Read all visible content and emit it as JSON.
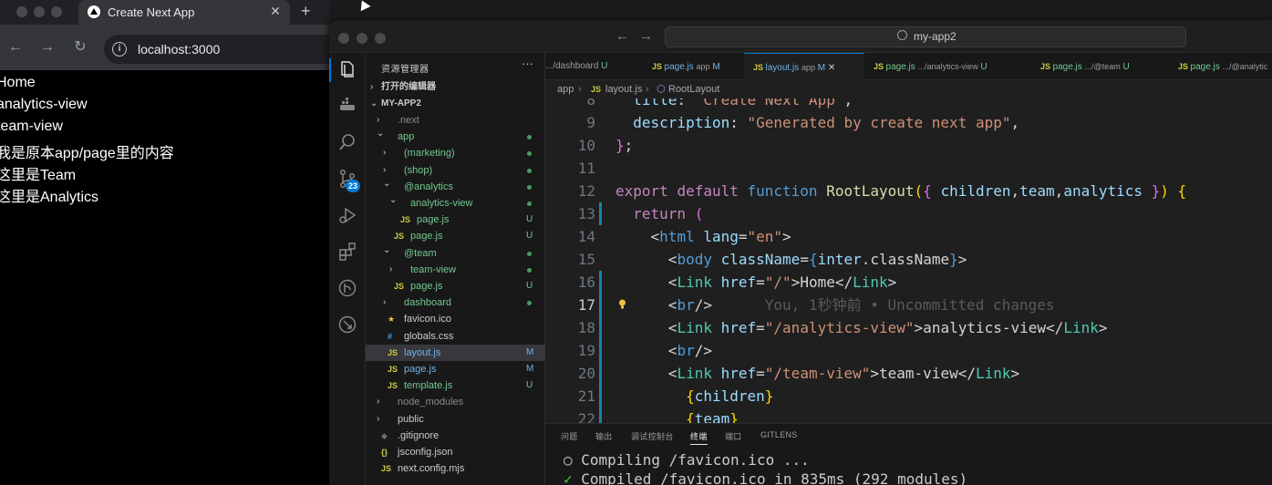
{
  "browser": {
    "tab_title": "Create Next App",
    "url": "localhost:3000",
    "close_glyph": "✕",
    "new_tab_glyph": "+",
    "back_glyph": "←",
    "forward_glyph": "→",
    "reload_glyph": "↻",
    "content_lines": [
      "Home",
      "analytics-view",
      "team-view",
      "我是原本app/page里的内容",
      "这里是Team",
      "这里是Analytics"
    ]
  },
  "vscode": {
    "title_search": "my-app2",
    "explorer": {
      "title": "资源管理器",
      "more": "···",
      "open_editors": "打开的编辑器",
      "project": "MY-APP2",
      "tree": [
        {
          "label": ".next",
          "type": "folder-closed",
          "indent": 0,
          "label_color": "#8b8b8b"
        },
        {
          "label": "app",
          "type": "folder-open",
          "indent": 0,
          "label_color": "#73c991",
          "dot": "#4a9a66"
        },
        {
          "label": "(marketing)",
          "type": "folder-closed",
          "indent": 1,
          "label_color": "#73c991",
          "dot": "#4a9a66"
        },
        {
          "label": "(shop)",
          "type": "folder-closed",
          "indent": 1,
          "label_color": "#73c991",
          "dot": "#4a9a66"
        },
        {
          "label": "@analytics",
          "type": "folder-open",
          "indent": 1,
          "label_color": "#73c991",
          "dot": "#4a9a66"
        },
        {
          "label": "analytics-view",
          "type": "folder-open",
          "indent": 2,
          "label_color": "#73c991",
          "dot": "#4a9a66"
        },
        {
          "label": "page.js",
          "type": "file-js",
          "indent": 3,
          "label_color": "#73c991",
          "status": "U",
          "status_color": "#73c991"
        },
        {
          "label": "page.js",
          "type": "file-js",
          "indent": 2,
          "label_color": "#73c991",
          "status": "U",
          "status_color": "#73c991"
        },
        {
          "label": "@team",
          "type": "folder-open",
          "indent": 1,
          "label_color": "#73c991",
          "dot": "#4a9a66"
        },
        {
          "label": "team-view",
          "type": "folder-closed",
          "indent": 2,
          "label_color": "#73c991",
          "dot": "#4a9a66"
        },
        {
          "label": "page.js",
          "type": "file-js",
          "indent": 2,
          "label_color": "#73c991",
          "status": "U",
          "status_color": "#73c991"
        },
        {
          "label": "dashboard",
          "type": "folder-closed",
          "indent": 1,
          "label_color": "#73c991",
          "dot": "#4a9a66"
        },
        {
          "label": "favicon.ico",
          "type": "file-star",
          "indent": 1,
          "label_color": "#cccccc"
        },
        {
          "label": "globals.css",
          "type": "file-css",
          "indent": 1,
          "label_color": "#cccccc"
        },
        {
          "label": "layout.js",
          "type": "file-js",
          "indent": 1,
          "label_color": "#6fb3e9",
          "status": "M",
          "status_color": "#6fb3e9",
          "selected": true
        },
        {
          "label": "page.js",
          "type": "file-js",
          "indent": 1,
          "label_color": "#6fb3e9",
          "status": "M",
          "status_color": "#6fb3e9"
        },
        {
          "label": "template.js",
          "type": "file-js",
          "indent": 1,
          "label_color": "#73c991",
          "status": "U",
          "status_color": "#73c991"
        },
        {
          "label": "node_modules",
          "type": "folder-closed",
          "indent": 0,
          "label_color": "#8b8b8b"
        },
        {
          "label": "public",
          "type": "folder-closed",
          "indent": 0,
          "label_color": "#cccccc"
        },
        {
          "label": ".gitignore",
          "type": "file-git",
          "indent": 0,
          "label_color": "#cccccc"
        },
        {
          "label": "jsconfig.json",
          "type": "file-json",
          "indent": 0,
          "label_color": "#cccccc"
        },
        {
          "label": "next.config.mjs",
          "type": "file-js",
          "indent": 0,
          "label_color": "#cccccc"
        }
      ]
    },
    "scm_badge": "23",
    "tabs": [
      {
        "name": "",
        "path": ".../dashboard",
        "status": "U",
        "status_color": "#73c991",
        "name_color": "#73c991",
        "show_js": false
      },
      {
        "name": "page.js",
        "path": "app",
        "status": "M",
        "status_color": "#6fb3e9",
        "name_color": "#6fb3e9",
        "show_js": true
      },
      {
        "name": "layout.js",
        "path": "app",
        "status": "M",
        "status_color": "#6fb3e9",
        "name_color": "#6fb3e9",
        "show_js": true,
        "active": true,
        "close": "✕"
      },
      {
        "name": "page.js",
        "path": ".../analytics-view",
        "status": "U",
        "status_color": "#73c991",
        "name_color": "#73c991",
        "show_js": true
      },
      {
        "name": "page.js",
        "path": ".../@team",
        "status": "U",
        "status_color": "#73c991",
        "name_color": "#73c991",
        "show_js": true
      },
      {
        "name": "page.js",
        "path": ".../@analytic",
        "status": "",
        "status_color": "#73c991",
        "name_color": "#73c991",
        "show_js": true
      }
    ],
    "breadcrumb": {
      "folder": "app",
      "sep": "›",
      "file": "layout.js",
      "symbol": "RootLayout"
    },
    "code_lines": [
      {
        "n": "8",
        "tokens": [
          [
            "  ",
            "c-txt"
          ],
          [
            "title",
            "c-key"
          ],
          [
            ": ",
            "c-txt"
          ],
          [
            "\"Create Next App\"",
            "c-str"
          ],
          [
            ",",
            "c-txt"
          ]
        ]
      },
      {
        "n": "9",
        "tokens": [
          [
            "  ",
            "c-txt"
          ],
          [
            "description",
            "c-key"
          ],
          [
            ": ",
            "c-txt"
          ],
          [
            "\"Generated by create next app\"",
            "c-str"
          ],
          [
            ",",
            "c-txt"
          ]
        ]
      },
      {
        "n": "10",
        "tokens": [
          [
            "}",
            "c-brace2"
          ],
          [
            ";",
            "c-txt"
          ]
        ]
      },
      {
        "n": "11",
        "tokens": []
      },
      {
        "n": "12",
        "tokens": [
          [
            "export ",
            "c-kw"
          ],
          [
            "default ",
            "c-kw"
          ],
          [
            "function ",
            "c-tag"
          ],
          [
            "RootLayout",
            "c-fn"
          ],
          [
            "(",
            "c-brace"
          ],
          [
            "{ ",
            "c-brace2"
          ],
          [
            "children",
            "c-var"
          ],
          [
            ",",
            "c-txt"
          ],
          [
            "team",
            "c-var"
          ],
          [
            ",",
            "c-txt"
          ],
          [
            "analytics",
            "c-var"
          ],
          [
            " }",
            "c-brace2"
          ],
          [
            ") ",
            "c-brace"
          ],
          [
            "{",
            "c-brace"
          ]
        ]
      },
      {
        "n": "13",
        "tokens": [
          [
            "  ",
            "c-txt"
          ],
          [
            "return ",
            "c-kw"
          ],
          [
            "(",
            "c-brace2"
          ]
        ]
      },
      {
        "n": "14",
        "tokens": [
          [
            "    ",
            "c-txt"
          ],
          [
            "<",
            "c-txt"
          ],
          [
            "html ",
            "c-tag"
          ],
          [
            "lang",
            "c-attr"
          ],
          [
            "=",
            "c-txt"
          ],
          [
            "\"en\"",
            "c-str"
          ],
          [
            ">",
            "c-txt"
          ]
        ]
      },
      {
        "n": "15",
        "tokens": [
          [
            "      ",
            "c-txt"
          ],
          [
            "<",
            "c-txt"
          ],
          [
            "body ",
            "c-tag"
          ],
          [
            "className",
            "c-attr"
          ],
          [
            "=",
            "c-txt"
          ],
          [
            "{",
            "c-tag"
          ],
          [
            "inter",
            "c-var"
          ],
          [
            ".className",
            "c-txt"
          ],
          [
            "}",
            "c-tag"
          ],
          [
            ">",
            "c-txt"
          ]
        ]
      },
      {
        "n": "16",
        "tokens": [
          [
            "      ",
            "c-txt"
          ],
          [
            "<",
            "c-txt"
          ],
          [
            "Link ",
            "c-comp"
          ],
          [
            "href",
            "c-attr"
          ],
          [
            "=",
            "c-txt"
          ],
          [
            "\"/\"",
            "c-str"
          ],
          [
            ">Home</",
            "c-txt"
          ],
          [
            "Link",
            "c-comp"
          ],
          [
            ">",
            "c-txt"
          ]
        ]
      },
      {
        "n": "17",
        "tokens": [
          [
            "      ",
            "c-txt"
          ],
          [
            "<",
            "c-txt"
          ],
          [
            "br",
            "c-tag"
          ],
          [
            "/>",
            "c-txt"
          ],
          [
            "      You, 1秒钟前 • Uncommitted changes",
            "c-blame"
          ]
        ],
        "current": true
      },
      {
        "n": "18",
        "tokens": [
          [
            "      ",
            "c-txt"
          ],
          [
            "<",
            "c-txt"
          ],
          [
            "Link ",
            "c-comp"
          ],
          [
            "href",
            "c-attr"
          ],
          [
            "=",
            "c-txt"
          ],
          [
            "\"/analytics-view\"",
            "c-str"
          ],
          [
            ">analytics-view</",
            "c-txt"
          ],
          [
            "Link",
            "c-comp"
          ],
          [
            ">",
            "c-txt"
          ]
        ]
      },
      {
        "n": "19",
        "tokens": [
          [
            "      ",
            "c-txt"
          ],
          [
            "<",
            "c-txt"
          ],
          [
            "br",
            "c-tag"
          ],
          [
            "/>",
            "c-txt"
          ]
        ]
      },
      {
        "n": "20",
        "tokens": [
          [
            "      ",
            "c-txt"
          ],
          [
            "<",
            "c-txt"
          ],
          [
            "Link ",
            "c-comp"
          ],
          [
            "href",
            "c-attr"
          ],
          [
            "=",
            "c-txt"
          ],
          [
            "\"/team-view\"",
            "c-str"
          ],
          [
            ">team-view</",
            "c-txt"
          ],
          [
            "Link",
            "c-comp"
          ],
          [
            ">",
            "c-txt"
          ]
        ]
      },
      {
        "n": "21",
        "tokens": [
          [
            "        ",
            "c-txt"
          ],
          [
            "{",
            "c-brace"
          ],
          [
            "children",
            "c-var"
          ],
          [
            "}",
            "c-brace"
          ]
        ]
      },
      {
        "n": "22",
        "tokens": [
          [
            "        ",
            "c-txt"
          ],
          [
            "{",
            "c-brace"
          ],
          [
            "team",
            "c-var"
          ],
          [
            "}",
            "c-brace"
          ]
        ]
      }
    ],
    "panel": {
      "tabs": [
        "问题",
        "输出",
        "调试控制台",
        "终端",
        "端口",
        "GITLENS"
      ],
      "active_tab": 3,
      "terminal": [
        {
          "prefix": "○",
          "prefix_color": "#cccccc",
          "text": "Compiling /favicon.ico ..."
        },
        {
          "prefix": "✓",
          "prefix_color": "#4ec94e",
          "text": "Compiled /favicon.ico in 835ms (292 modules)"
        }
      ]
    }
  }
}
